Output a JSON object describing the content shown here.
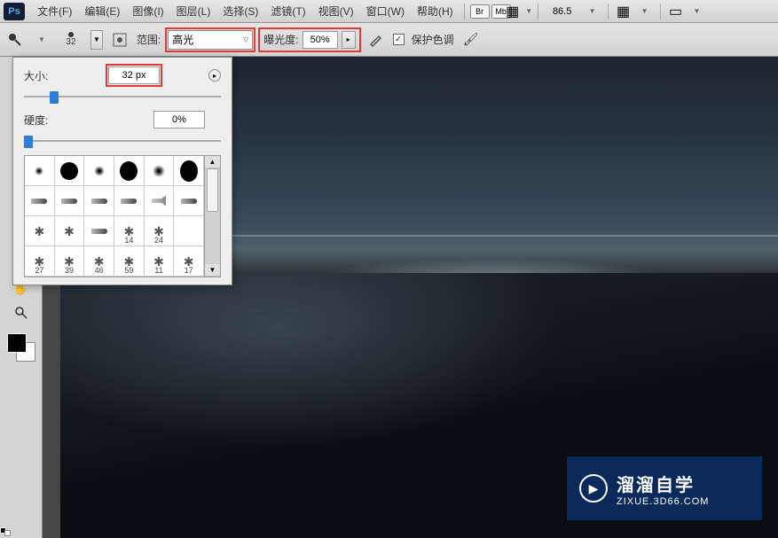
{
  "menu": {
    "items": [
      {
        "label": "文件(F)"
      },
      {
        "label": "编辑(E)"
      },
      {
        "label": "图像(I)"
      },
      {
        "label": "图层(L)"
      },
      {
        "label": "选择(S)"
      },
      {
        "label": "滤镜(T)"
      },
      {
        "label": "视图(V)"
      },
      {
        "label": "窗口(W)"
      },
      {
        "label": "帮助(H)"
      }
    ],
    "badges": [
      "Br",
      "Mb"
    ],
    "zoom_value": "86.5"
  },
  "options": {
    "brush_size_small": "32",
    "range_label": "范围:",
    "range_value": "高光",
    "exposure_label": "曝光度:",
    "exposure_value": "50%",
    "protect_tone_label": "保护色调",
    "protect_tone_checked": true
  },
  "brush_panel": {
    "size_label": "大小:",
    "size_value": "32 px",
    "size_pct": 13,
    "hardness_label": "硬度:",
    "hardness_value": "0%",
    "hardness_pct": 0,
    "presets": [
      {
        "type": "soft",
        "size": 10,
        "label": ""
      },
      {
        "type": "hard",
        "size": 20,
        "label": ""
      },
      {
        "type": "soft",
        "size": 12,
        "label": ""
      },
      {
        "type": "hard",
        "size": 22,
        "label": ""
      },
      {
        "type": "soft",
        "size": 14,
        "label": ""
      },
      {
        "type": "hard",
        "size": 24,
        "label": ""
      },
      {
        "type": "brush",
        "label": ""
      },
      {
        "type": "brush",
        "label": ""
      },
      {
        "type": "brush",
        "label": ""
      },
      {
        "type": "brush",
        "label": ""
      },
      {
        "type": "spray",
        "label": ""
      },
      {
        "type": "brush",
        "label": ""
      },
      {
        "type": "splat",
        "label": ""
      },
      {
        "type": "splat",
        "label": ""
      },
      {
        "type": "brush",
        "label": ""
      },
      {
        "type": "splat",
        "label": "14"
      },
      {
        "type": "splat",
        "label": "24"
      },
      {
        "type": "blank",
        "label": ""
      },
      {
        "type": "splat",
        "label": "27"
      },
      {
        "type": "splat",
        "label": "39"
      },
      {
        "type": "splat",
        "label": "46"
      },
      {
        "type": "splat",
        "label": "59"
      },
      {
        "type": "splat",
        "label": "11"
      },
      {
        "type": "splat",
        "label": "17"
      }
    ]
  },
  "watermark": {
    "title": "溜溜自学",
    "sub": "ZIXUE.3D66.COM"
  },
  "colors": {
    "highlight": "#e53935",
    "accent": "#2a7ed6",
    "watermark_bg": "#0b2a5c"
  }
}
